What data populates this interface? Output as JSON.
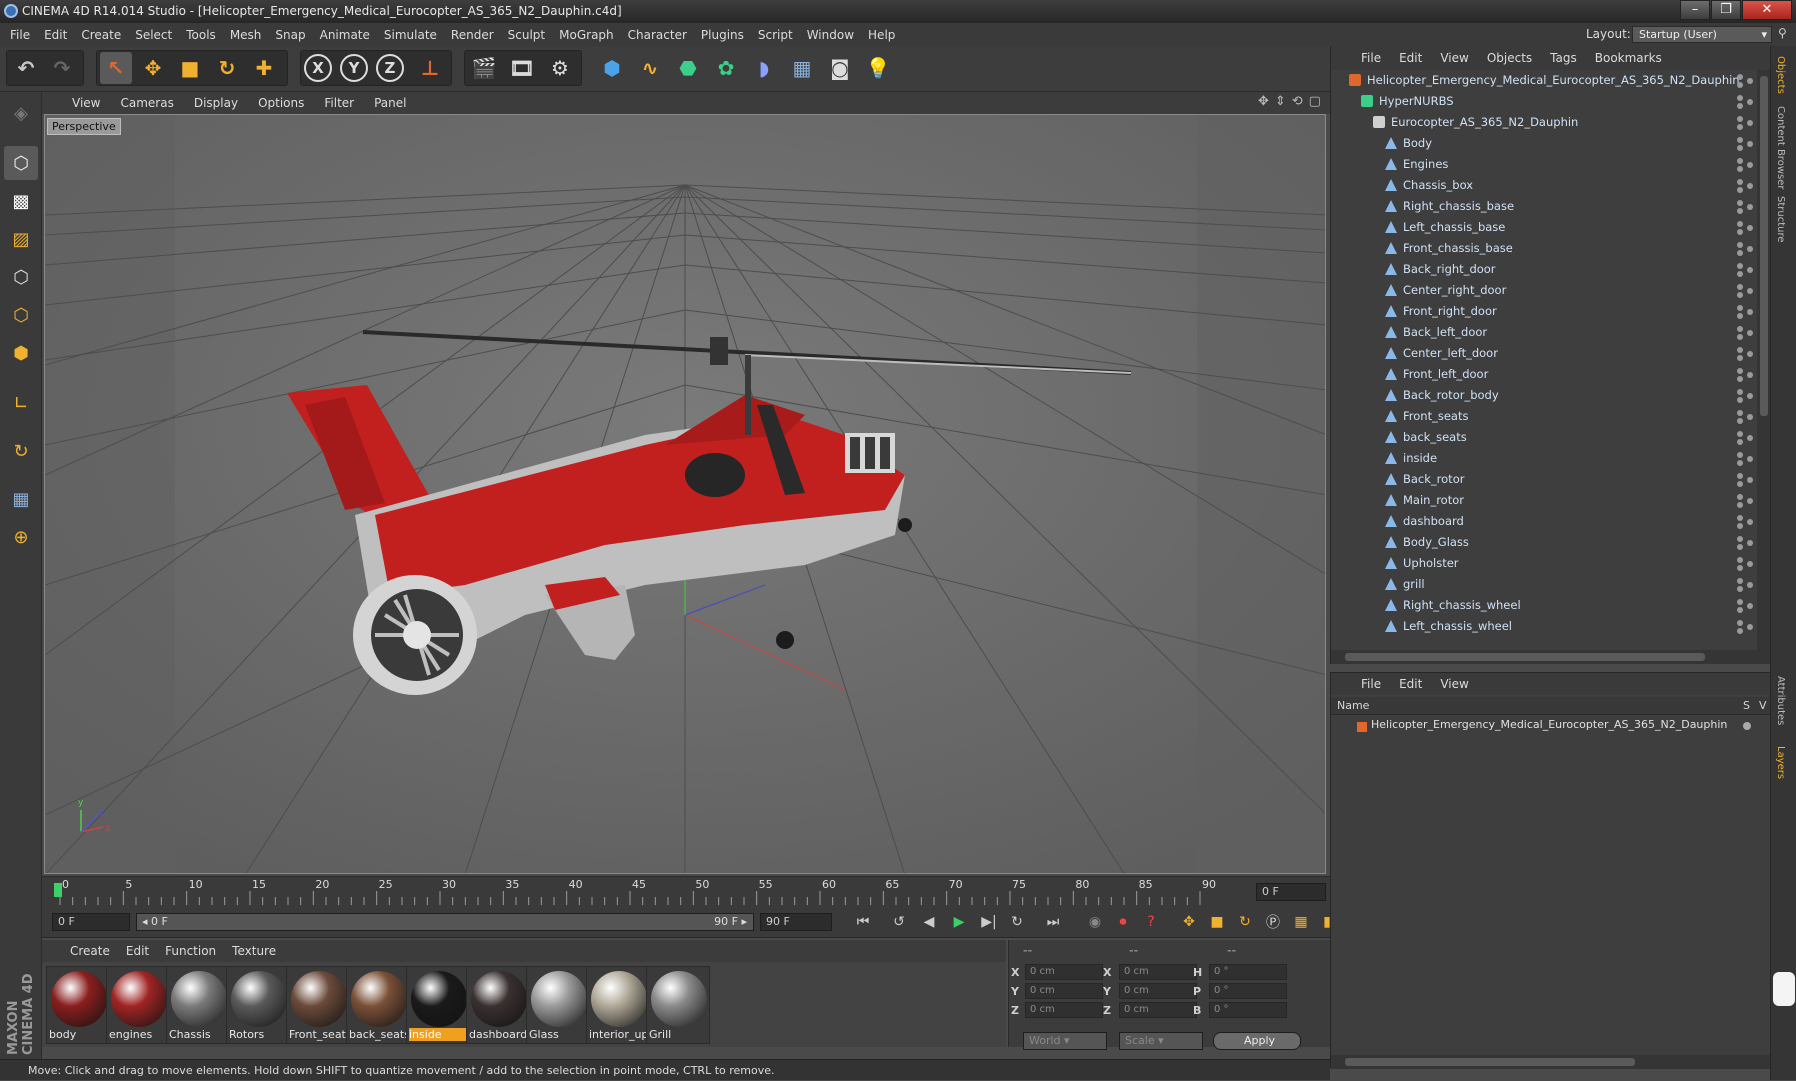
{
  "window": {
    "title": "CINEMA 4D R14.014 Studio - [Helicopter_Emergency_Medical_Eurocopter_AS_365_N2_Dauphin.c4d]",
    "minimize": "–",
    "restore": "❐",
    "close": "✕"
  },
  "menu": [
    "File",
    "Edit",
    "Create",
    "Select",
    "Tools",
    "Mesh",
    "Snap",
    "Animate",
    "Simulate",
    "Render",
    "Sculpt",
    "MoGraph",
    "Character",
    "Plugins",
    "Script",
    "Window",
    "Help"
  ],
  "layout": {
    "label": "Layout:",
    "value": "Startup (User)"
  },
  "toolbar": {
    "x_label": "X",
    "y_label": "Y",
    "z_label": "Z"
  },
  "viewport": {
    "menu": [
      "View",
      "Cameras",
      "Display",
      "Options",
      "Filter",
      "Panel"
    ],
    "label": "Perspective"
  },
  "timeline": {
    "ticks": [
      "0",
      "5",
      "10",
      "15",
      "20",
      "25",
      "30",
      "35",
      "40",
      "45",
      "50",
      "55",
      "60",
      "65",
      "70",
      "75",
      "80",
      "85",
      "90"
    ],
    "end_field": "0 F"
  },
  "transport": {
    "start": "0 F",
    "range_left": "◂ 0 F",
    "range_right": "90 F ▸",
    "end": "90 F"
  },
  "materials": {
    "menu": [
      "Create",
      "Edit",
      "Function",
      "Texture"
    ],
    "items": [
      {
        "name": "body",
        "color": "#8a1e1e"
      },
      {
        "name": "engines",
        "color": "#a02424"
      },
      {
        "name": "Chassis",
        "color": "#7a7a7a"
      },
      {
        "name": "Rotors",
        "color": "#5a5a5a"
      },
      {
        "name": "Front_seats",
        "color": "#6b4a3a"
      },
      {
        "name": "back_seats",
        "color": "#7a5038"
      },
      {
        "name": "inside",
        "color": "#1a1a1a"
      },
      {
        "name": "dashboard",
        "color": "#3a3030"
      },
      {
        "name": "Glass",
        "color": "#9a9a9a"
      },
      {
        "name": "interior_up",
        "color": "#b0a898"
      },
      {
        "name": "Grill",
        "color": "#8a8a8a"
      }
    ]
  },
  "coords": {
    "headers": [
      "--",
      "--",
      "--"
    ],
    "rows": [
      {
        "a": "X",
        "av": "0 cm",
        "b": "X",
        "bv": "0 cm",
        "c": "H",
        "cv": "0 °"
      },
      {
        "a": "Y",
        "av": "0 cm",
        "b": "Y",
        "bv": "0 cm",
        "c": "P",
        "cv": "0 °"
      },
      {
        "a": "Z",
        "av": "0 cm",
        "b": "Z",
        "bv": "0 cm",
        "c": "B",
        "cv": "0 °"
      }
    ],
    "world": "World",
    "scale": "Scale",
    "apply": "Apply"
  },
  "status": "Move: Click and drag to move elements. Hold down SHIFT to quantize movement / add to the selection in point mode, CTRL to remove.",
  "objects": {
    "menu": [
      "File",
      "Edit",
      "View",
      "Objects",
      "Tags",
      "Bookmarks"
    ],
    "root": "Helicopter_Emergency_Medical_Eurocopter_AS_365_N2_Dauphin",
    "hypernurbs": "HyperNURBS",
    "group": "Eurocopter_AS_365_N2_Dauphin",
    "children": [
      "Body",
      "Engines",
      "Chassis_box",
      "Right_chassis_base",
      "Left_chassis_base",
      "Front_chassis_base",
      "Back_right_door",
      "Center_right_door",
      "Front_right_door",
      "Back_left_door",
      "Center_left_door",
      "Front_left_door",
      "Back_rotor_body",
      "Front_seats",
      "back_seats",
      "inside",
      "Back_rotor",
      "Main_rotor",
      "dashboard",
      "Body_Glass",
      "Upholster",
      "grill",
      "Right_chassis_wheel",
      "Left_chassis_wheel"
    ]
  },
  "layers": {
    "menu": [
      "File",
      "Edit",
      "View"
    ],
    "col_name": "Name",
    "col_s": "S",
    "col_v": "V",
    "item": "Helicopter_Emergency_Medical_Eurocopter_AS_365_N2_Dauphin"
  },
  "side_tabs": [
    "Objects",
    "Content Browser",
    "Structure",
    "Attributes",
    "Layers"
  ],
  "maxon": "MAXON CINEMA 4D"
}
